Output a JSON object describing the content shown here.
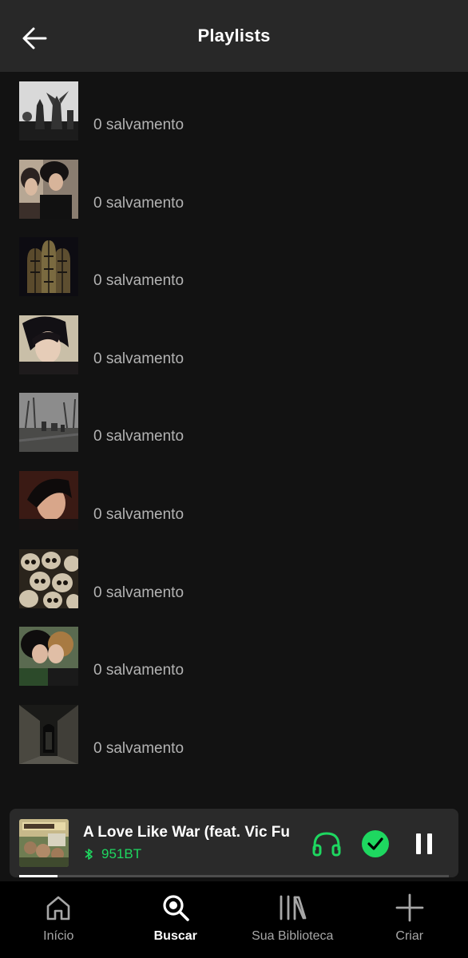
{
  "header": {
    "title": "Playlists"
  },
  "playlists": [
    {
      "label": "0 salvamento",
      "art": "gothic-angel-statue"
    },
    {
      "label": "0 salvamento",
      "art": "two-emo-boys"
    },
    {
      "label": "0 salvamento",
      "art": "stained-glass-window"
    },
    {
      "label": "0 salvamento",
      "art": "emo-boy-portrait"
    },
    {
      "label": "0 salvamento",
      "art": "misty-cemetery"
    },
    {
      "label": "0 salvamento",
      "art": "emo-boy-selfie"
    },
    {
      "label": "0 salvamento",
      "art": "pile-of-skulls"
    },
    {
      "label": "0 salvamento",
      "art": "two-boys-kissing"
    },
    {
      "label": "0 salvamento",
      "art": "dark-corridor"
    }
  ],
  "player": {
    "title": "A Love Like War (feat. Vic Fue",
    "device": "951BT",
    "progress": 0.09,
    "art": "all-time-low-album-cover"
  },
  "nav": {
    "items": [
      {
        "label": "Início",
        "icon": "home-icon",
        "active": false
      },
      {
        "label": "Buscar",
        "icon": "search-icon",
        "active": true
      },
      {
        "label": "Sua Biblioteca",
        "icon": "library-icon",
        "active": false
      },
      {
        "label": "Criar",
        "icon": "plus-icon",
        "active": false
      }
    ]
  },
  "colors": {
    "accent": "#1ed760",
    "background": "#121212",
    "header": "#282828",
    "player": "#2a2a2a",
    "nav": "#000000",
    "muted_text": "#b3b3b3"
  }
}
